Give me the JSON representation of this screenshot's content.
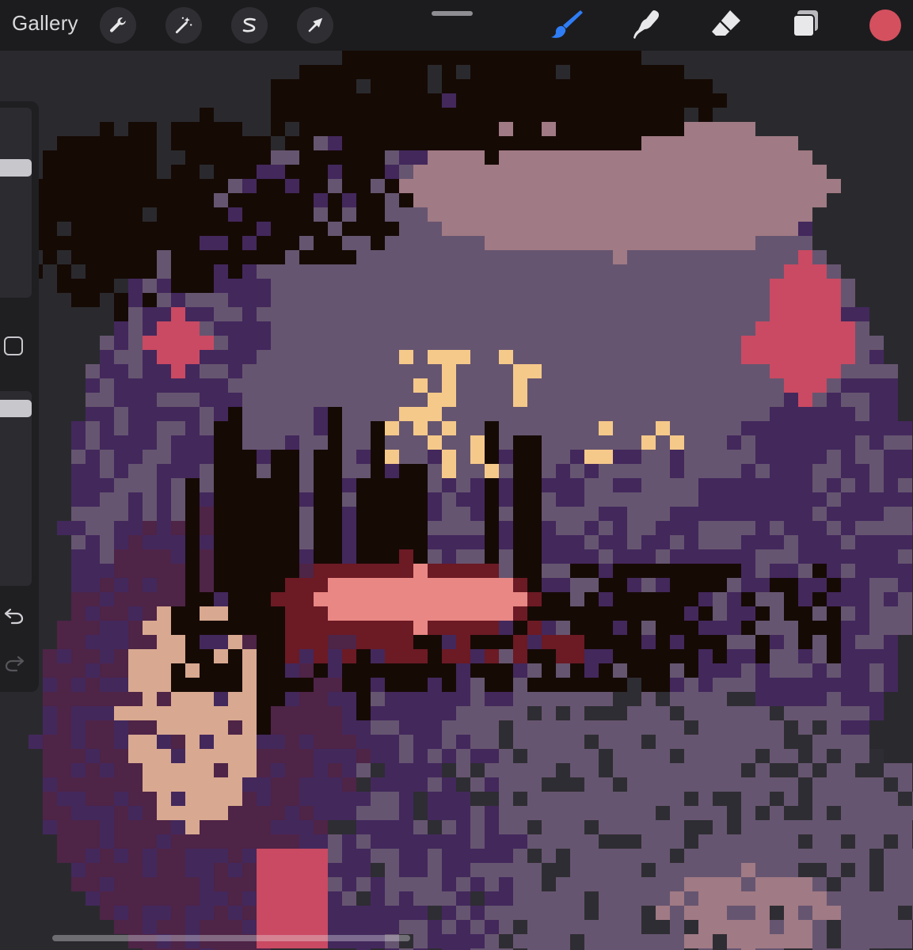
{
  "toolbar": {
    "gallery_label": "Gallery",
    "left_tools": [
      {
        "name": "actions",
        "icon": "wrench-icon"
      },
      {
        "name": "adjustments",
        "icon": "magic-wand-icon"
      },
      {
        "name": "selection",
        "icon": "selection-s-icon"
      },
      {
        "name": "transform",
        "icon": "arrow-cursor-icon"
      }
    ],
    "right_tools": [
      {
        "name": "brush",
        "icon": "brush-icon",
        "active": true,
        "color": "#2f7df6"
      },
      {
        "name": "smudge",
        "icon": "smudge-finger-icon",
        "active": false
      },
      {
        "name": "eraser",
        "icon": "eraser-icon",
        "active": false
      },
      {
        "name": "layers",
        "icon": "layers-icon",
        "active": false
      }
    ],
    "current_color": "#d4505e"
  },
  "sidebar": {
    "brush_size_level": 0.3,
    "opacity_level": 0.05,
    "modify_icon": "square-icon",
    "undo_icon": "undo-arrow-icon",
    "redo_icon": "redo-arrow-icon"
  },
  "palette": {
    "bg": "#2a2a2e",
    "black": "#160a05",
    "purple": "#43285c",
    "mauve": "#665570",
    "pink": "#a07a84",
    "red": "#c94a62",
    "yellow": "#f5c98a",
    "skin": "#d8a990",
    "darkred": "#6c1a24",
    "lip": "#e88784",
    "deeppurple": "#4e2447",
    "darkgrey": "#2e2d33"
  }
}
